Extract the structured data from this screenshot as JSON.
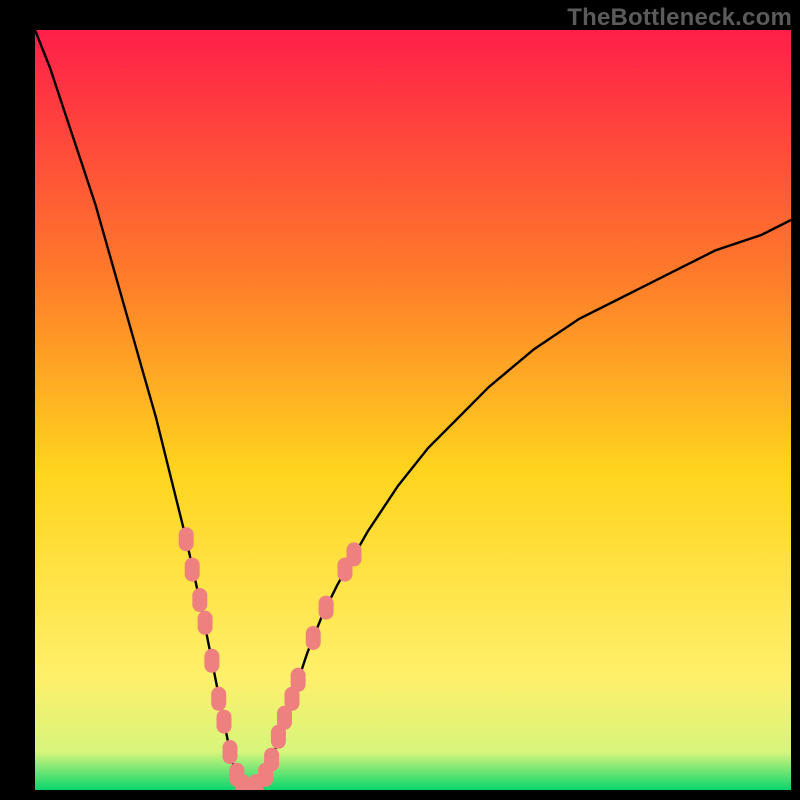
{
  "watermark": "TheBottleneck.com",
  "colors": {
    "bg": "#000000",
    "grad_top": "#ff1f4a",
    "grad_mid1": "#ff7a2a",
    "grad_mid2": "#ffd41e",
    "grad_mid3": "#fff06a",
    "grad_bottom": "#08d66c",
    "curve": "#000000",
    "marker": "#ef8080"
  },
  "chart_data": {
    "type": "line",
    "title": "",
    "xlabel": "",
    "ylabel": "",
    "xlim": [
      0,
      100
    ],
    "ylim": [
      0,
      100
    ],
    "legend": false,
    "grid": false,
    "annotations": [],
    "series": [
      {
        "name": "bottleneck-curve",
        "x": [
          0,
          2,
          4,
          6,
          8,
          10,
          12,
          14,
          16,
          18,
          20,
          22,
          23,
          24,
          25,
          26,
          27,
          28,
          29,
          30,
          31,
          32,
          34,
          36,
          38,
          40,
          44,
          48,
          52,
          56,
          60,
          66,
          72,
          78,
          84,
          90,
          96,
          100
        ],
        "y": [
          100,
          95,
          89,
          83,
          77,
          70,
          63,
          56,
          49,
          41,
          33,
          24,
          19,
          14,
          9,
          4,
          1,
          0,
          0,
          1,
          3,
          6,
          12,
          18,
          23,
          27,
          34,
          40,
          45,
          49,
          53,
          58,
          62,
          65,
          68,
          71,
          73,
          75
        ]
      }
    ],
    "markers": [
      {
        "x": 20.0,
        "y": 33
      },
      {
        "x": 20.8,
        "y": 29
      },
      {
        "x": 21.8,
        "y": 25
      },
      {
        "x": 22.5,
        "y": 22
      },
      {
        "x": 23.4,
        "y": 17
      },
      {
        "x": 24.3,
        "y": 12
      },
      {
        "x": 25.0,
        "y": 9
      },
      {
        "x": 25.8,
        "y": 5
      },
      {
        "x": 26.7,
        "y": 2
      },
      {
        "x": 27.5,
        "y": 0.5
      },
      {
        "x": 28.3,
        "y": 0
      },
      {
        "x": 29.2,
        "y": 0.5
      },
      {
        "x": 30.5,
        "y": 2
      },
      {
        "x": 31.3,
        "y": 4
      },
      {
        "x": 32.2,
        "y": 7
      },
      {
        "x": 33.0,
        "y": 9.5
      },
      {
        "x": 34.0,
        "y": 12
      },
      {
        "x": 34.8,
        "y": 14.5
      },
      {
        "x": 36.8,
        "y": 20
      },
      {
        "x": 38.5,
        "y": 24
      },
      {
        "x": 41.0,
        "y": 29
      },
      {
        "x": 42.2,
        "y": 31
      }
    ]
  }
}
